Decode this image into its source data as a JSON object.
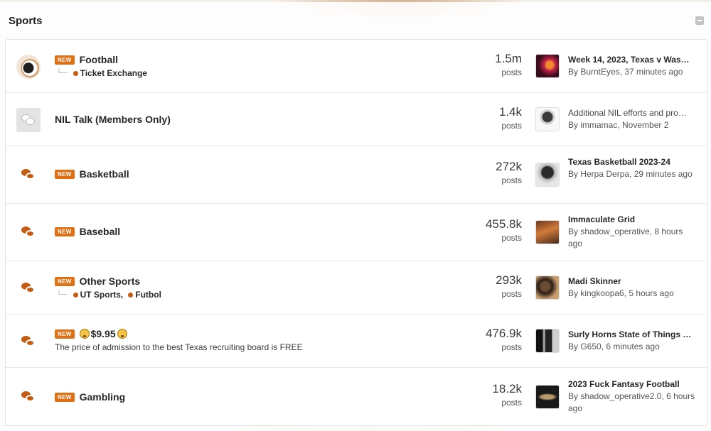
{
  "category": {
    "title": "Sports"
  },
  "new_badge": "NEW",
  "posts_label": "posts",
  "forums": [
    {
      "title": "Football",
      "subforums": [
        "Ticket Exchange"
      ],
      "stat": "1.5m",
      "latest_title": "Week 14, 2023, Texas v Was…",
      "latest_by": "By BurntEyes, 37 minutes ago",
      "thumb_color": "#8c1a2e"
    },
    {
      "title": "NIL Talk (Members Only)",
      "stat": "1.4k",
      "latest_title": "Additional NIL efforts and pro…",
      "latest_by": "By immamac, November 2",
      "thumb_color": "#e8e8e8"
    },
    {
      "title": "Basketball",
      "stat": "272k",
      "latest_title": "Texas Basketball 2023-24",
      "latest_by": "By Herpa Derpa, 29 minutes ago",
      "thumb_color": "#8a8a8a"
    },
    {
      "title": "Baseball",
      "stat": "455.8k",
      "latest_title": "Immaculate Grid",
      "latest_by": "By shadow_operative, 8 hours ago",
      "thumb_color": "#a3542a"
    },
    {
      "title": "Other Sports",
      "subforums": [
        "UT Sports,",
        "Futbol"
      ],
      "stat": "293k",
      "latest_title": "Madi Skinner",
      "latest_by": "By kingkoopa6, 5 hours ago",
      "thumb_color": "#3b2a1e"
    },
    {
      "title": "$9.95",
      "description": "The price of admission to the best Texas recruiting board is FREE",
      "stat": "476.9k",
      "latest_title": "Surly Horns State of Things E…",
      "latest_by": "By G650, 6 minutes ago",
      "thumb_color": "#2a2a2a"
    },
    {
      "title": "Gambling",
      "stat": "18.2k",
      "latest_title": "2023 Fuck Fantasy Football",
      "latest_by": "By shadow_operative2.0, 6 hours ago",
      "thumb_color": "#1f1f1f"
    }
  ]
}
